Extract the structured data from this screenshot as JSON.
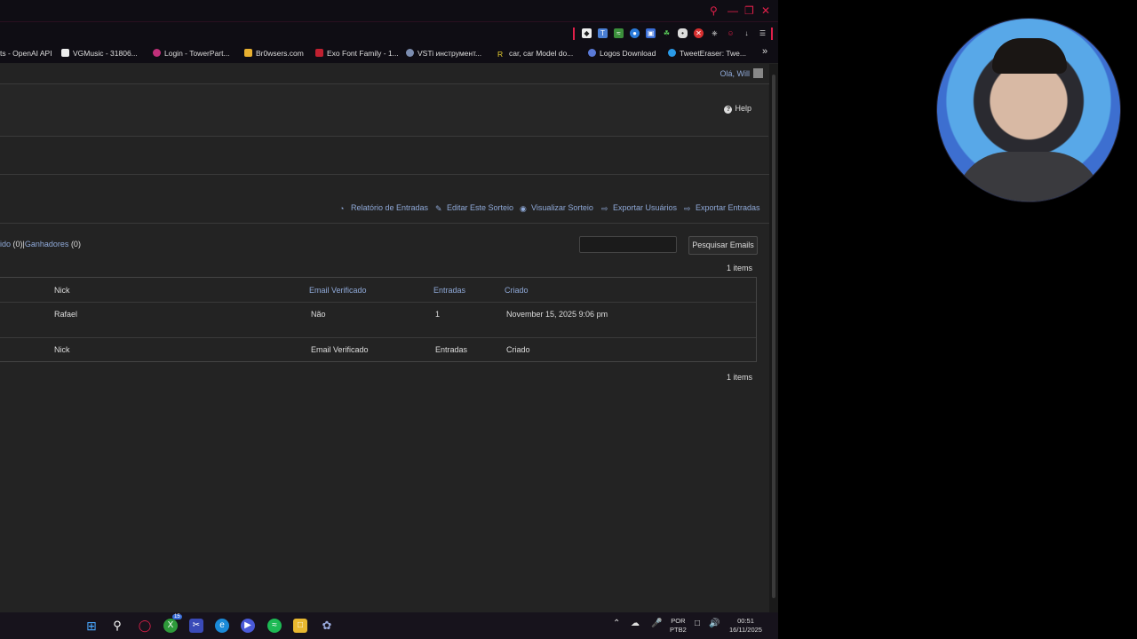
{
  "bookmarks": [
    {
      "label": "ts - OpenAI API",
      "icon": "none"
    },
    {
      "label": "VGMusic - 31806...",
      "icon": "vgmusic-icon"
    },
    {
      "label": "Login - TowerPart...",
      "icon": "towerpart-icon"
    },
    {
      "label": "Br0wsers.com",
      "icon": "browsers-icon"
    },
    {
      "label": "Exo Font Family - 1...",
      "icon": "fontfamily-icon"
    },
    {
      "label": "VSTi инструмент...",
      "icon": "vsti-icon"
    },
    {
      "label": "car, car Model do...",
      "icon": "car-icon"
    },
    {
      "label": "Logos Download",
      "icon": "logos-icon"
    },
    {
      "label": "TweetEraser: Twe...",
      "icon": "tweeteraser-icon"
    }
  ],
  "adminbar": {
    "greeting": "Olá, Will"
  },
  "help": {
    "label": "Help"
  },
  "actions": [
    {
      "label": "Relatório de Entradas",
      "icon": "chart-icon"
    },
    {
      "label": "Editar Este Sorteio",
      "icon": "pencil-icon"
    },
    {
      "label": "Visualizar Sorteio",
      "icon": "eye-icon"
    },
    {
      "label": "Exportar Usuários",
      "icon": "export-icon"
    },
    {
      "label": "Exportar Entradas",
      "icon": "export-icon"
    }
  ],
  "filters": {
    "first_link": "ido",
    "first_count": "(0)",
    "separator": "|",
    "second_link": "Ganhadores",
    "second_count": "(0)"
  },
  "search": {
    "button": "Pesquisar Emails",
    "value": ""
  },
  "count_top": "1 items",
  "count_bottom": "1 items",
  "table": {
    "columns": [
      "Nick",
      "Email Verificado",
      "Entradas",
      "Criado"
    ],
    "rows": [
      {
        "nick": "Rafael",
        "email_verificado": "Não",
        "entradas": "1",
        "criado": "November 15, 2025 9:06 pm"
      }
    ],
    "footer": [
      "Nick",
      "Email Verificado",
      "Entradas",
      "Criado"
    ]
  },
  "tray": {
    "lang": "POR",
    "layout": "PTB2",
    "time": "00:51",
    "date": "16/11/2025"
  },
  "taskbar_badge": "15"
}
